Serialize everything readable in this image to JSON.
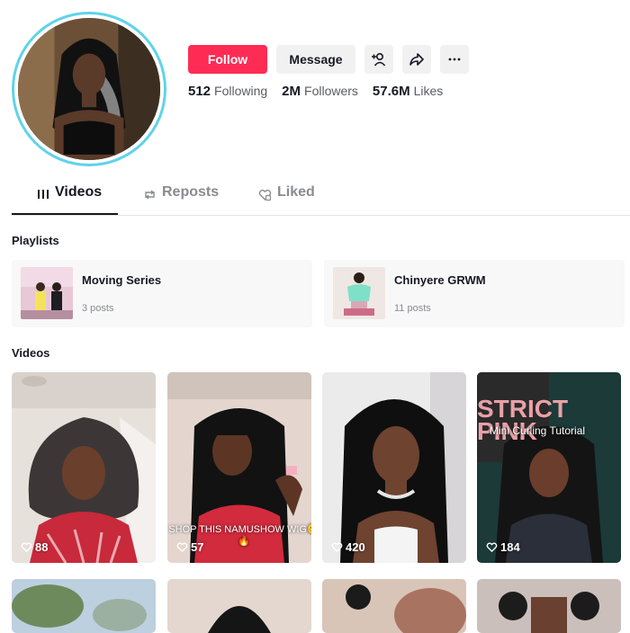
{
  "profile": {
    "follow_label": "Follow",
    "message_label": "Message",
    "stats": [
      {
        "value": "512",
        "label": "Following"
      },
      {
        "value": "2M",
        "label": "Followers"
      },
      {
        "value": "57.6M",
        "label": "Likes"
      }
    ]
  },
  "tabs": [
    {
      "label": "Videos",
      "icon": "grid-bars-icon",
      "active": true
    },
    {
      "label": "Reposts",
      "icon": "repost-icon",
      "active": false
    },
    {
      "label": "Liked",
      "icon": "liked-heart-icon",
      "active": false
    }
  ],
  "playlists": {
    "heading": "Playlists",
    "items": [
      {
        "title": "Moving Series",
        "count": "3 posts"
      },
      {
        "title": "Chinyere GRWM",
        "count": "11 posts"
      }
    ]
  },
  "videos": {
    "heading": "Videos",
    "items": [
      {
        "likes": "88"
      },
      {
        "likes": "57",
        "caption": "SHOP THIS NAMUSHOW WIG😊🔥"
      },
      {
        "likes": "420"
      },
      {
        "likes": "184",
        "caption": "Mini Curling Tutorial",
        "sign_text": "STRICT PINK"
      }
    ]
  },
  "colors": {
    "accent": "#fe2c55",
    "ring": "#5fd3ea"
  }
}
